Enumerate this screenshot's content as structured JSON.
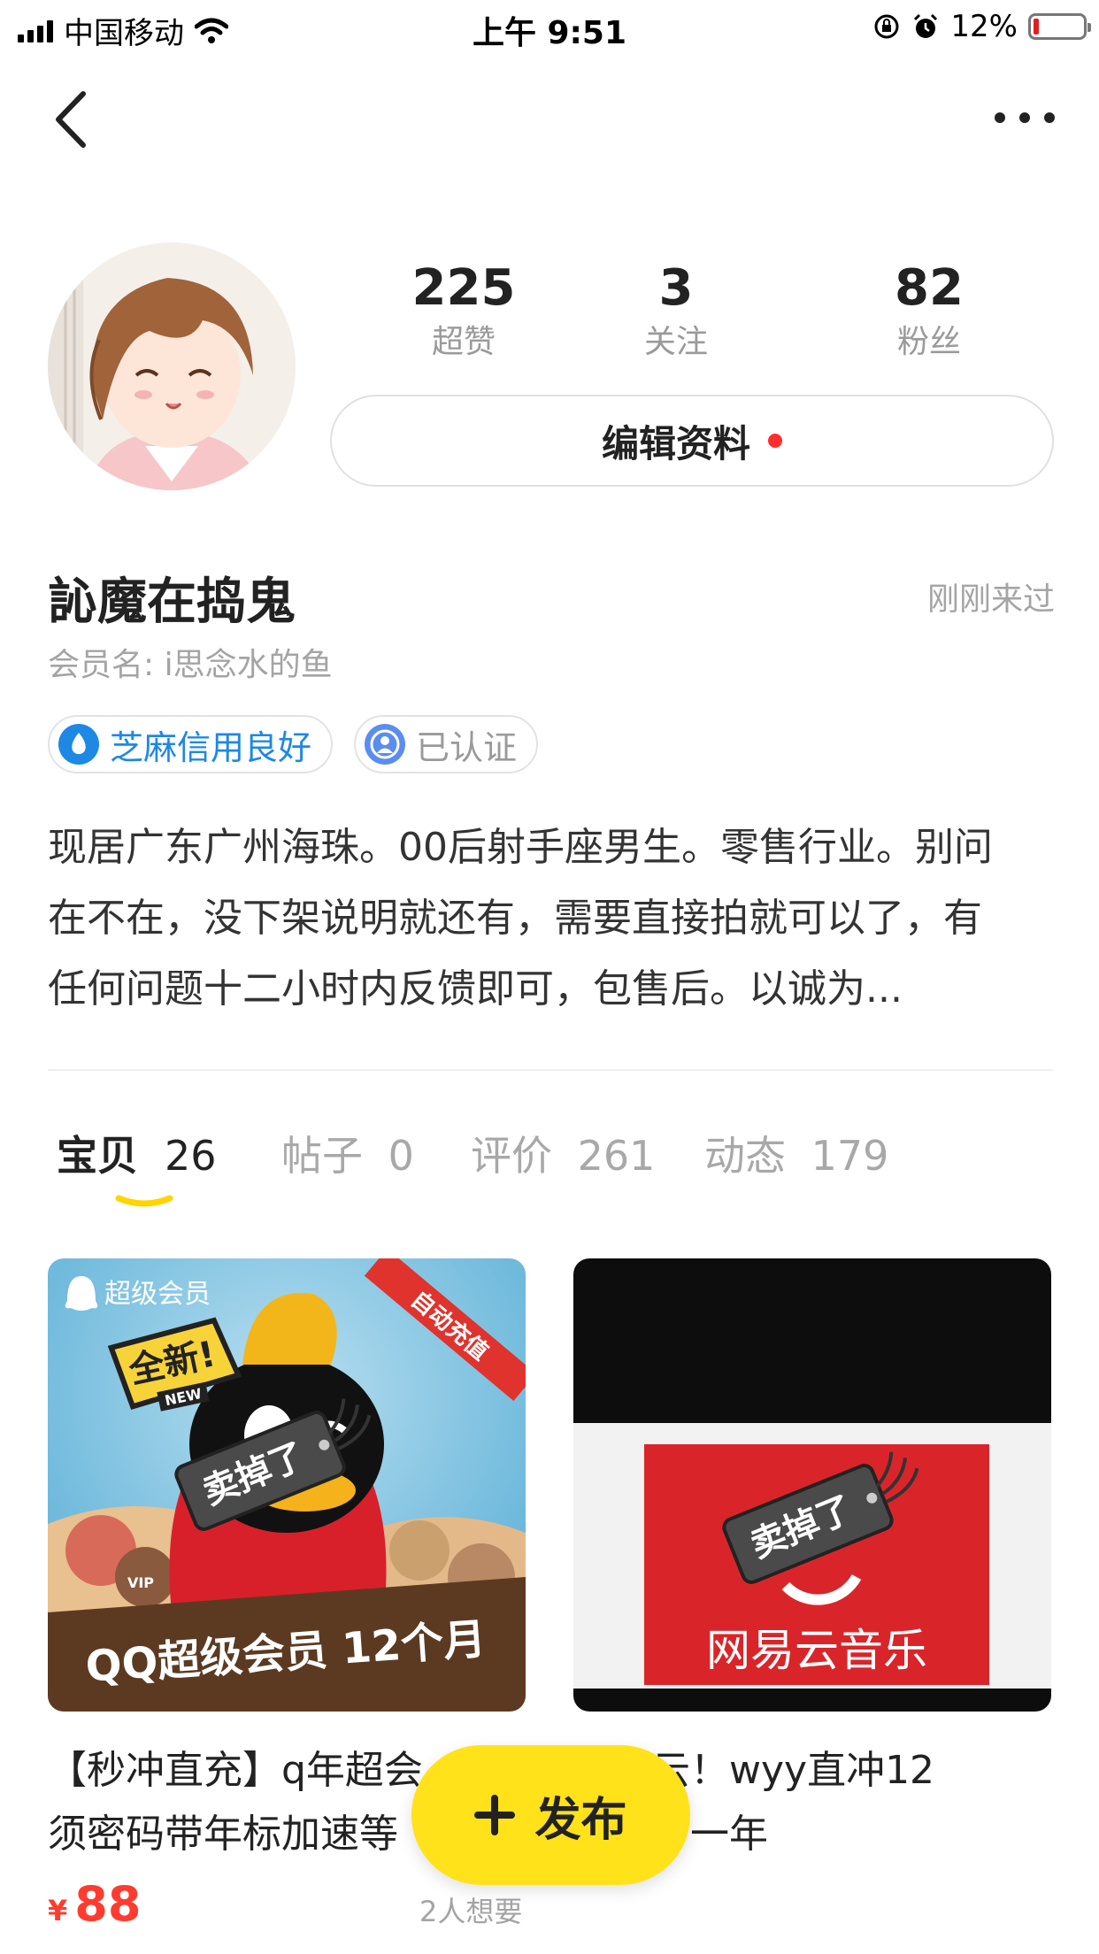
{
  "status_bar": {
    "carrier": "中国移动",
    "time": "上午 9:51",
    "battery": "12%",
    "battery_level": 0.12
  },
  "profile": {
    "stats": [
      {
        "value": "225",
        "label": "超赞"
      },
      {
        "value": "3",
        "label": "关注"
      },
      {
        "value": "82",
        "label": "粉丝"
      }
    ],
    "edit_button": "编辑资料",
    "nickname": "訫魔在捣鬼",
    "last_seen": "刚刚来过",
    "member_name": "会员名: i思念水的鱼",
    "badges": [
      {
        "label": "芝麻信用良好",
        "color": "#1e88e5"
      },
      {
        "label": "已认证",
        "color": "#5b8def"
      }
    ],
    "bio_lines": [
      "现居广东广州海珠。00后射手座男生。零售行业。别问",
      "在不在，没下架说明就还有，需要直接拍就可以了，有",
      "任何问题十二小时内反馈即可，包售后。以诚为..."
    ]
  },
  "tabs": [
    {
      "label": "宝贝",
      "count": "26",
      "active": true
    },
    {
      "label": "帖子",
      "count": "0",
      "active": false
    },
    {
      "label": "评价",
      "count": "261",
      "active": false
    },
    {
      "label": "动态",
      "count": "179",
      "active": false
    }
  ],
  "items": [
    {
      "image_texts": {
        "brand": "超级会员",
        "corner": "自动充值",
        "burst": "全新!",
        "new_tag": "NEW",
        "vip": "VIP",
        "bottom": "QQ超级会员 12个月",
        "sold": "卖掉了"
      },
      "title_lines": [
        "【秒冲直充】q年超会",
        "须密码带年标加速等"
      ],
      "currency": "¥",
      "price": "88",
      "wants": "2人想要"
    },
    {
      "image_texts": {
        "logo": "网易云音乐",
        "sold": "卖掉了"
      },
      "title_lines": [
        "网抑云！wyy直冲12",
        "个月，一年"
      ]
    }
  ],
  "fab": {
    "label": "发布"
  },
  "colors": {
    "accent": "#ffe21a",
    "price": "#ff3b30",
    "netease_red": "#d9252a"
  }
}
